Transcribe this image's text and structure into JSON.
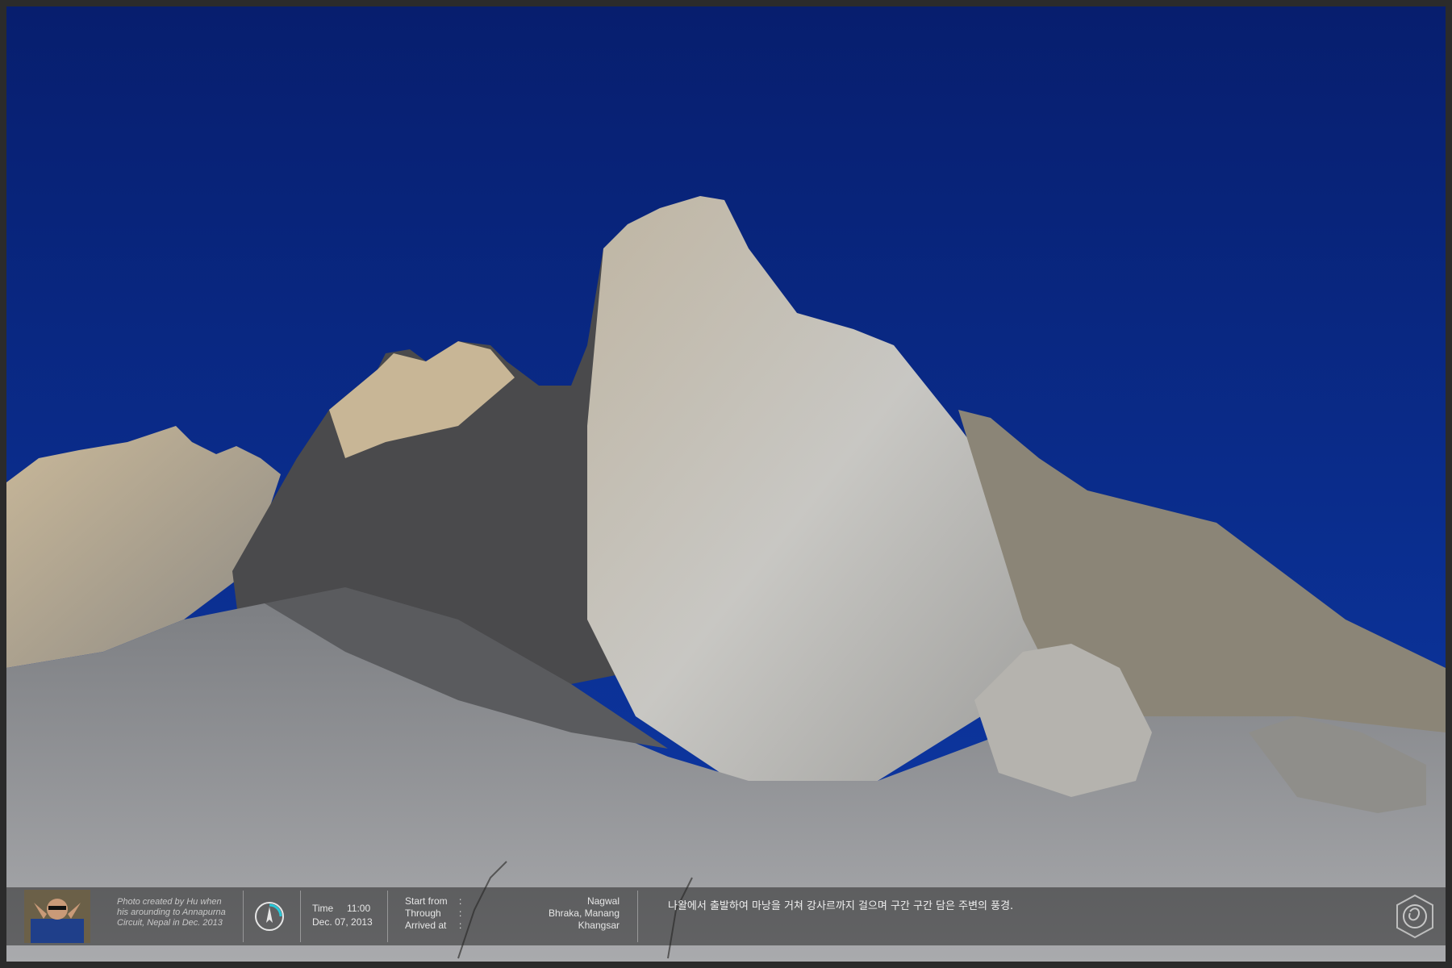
{
  "photo": {
    "description_icon": "mountain-photo",
    "colors": {
      "sky": "#0a2a8a",
      "rock": "#b7b3a8",
      "slope": "#8f9092"
    }
  },
  "infobar": {
    "credit": "Photo created by Hu when his arounding to Annapurna Circuit, Nepal in Dec. 2013",
    "time_label": "Time",
    "time_value": "11:00",
    "date_value": "Dec. 07, 2013",
    "route": {
      "start_label": "Start from",
      "through_label": "Through",
      "arrived_label": "Arrived at",
      "start_value": "Nagwal",
      "through_value": "Bhraka, Manang",
      "arrived_value": "Khangsar"
    },
    "caption": "나왈에서 출발하여 마낭을 거쳐 강사르까지 걸으며 구간 구간 담은 주변의 풍경.",
    "icons": {
      "avatar": "avatar",
      "compass": "compass-icon",
      "logo": "rose-logo"
    }
  }
}
